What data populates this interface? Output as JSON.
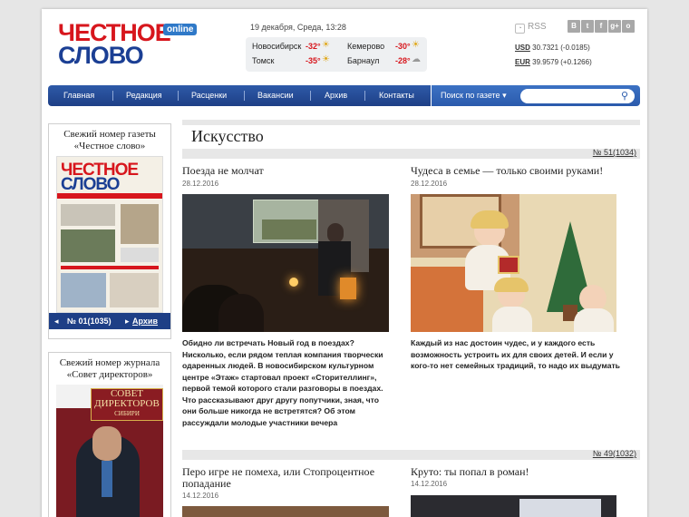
{
  "logo": {
    "line1": "ЧЕСТНОЕ",
    "line2": "СЛОВО",
    "badge": "online"
  },
  "header": {
    "date": "19 декабря, Среда,  13:28"
  },
  "weather": [
    {
      "city": "Новосибирск",
      "temp": "-32°"
    },
    {
      "city": "Кемерово",
      "temp": "-30°"
    },
    {
      "city": "Томск",
      "temp": "-35°"
    },
    {
      "city": "Барнаул",
      "temp": "-28°"
    }
  ],
  "rss": "RSS",
  "socials": [
    "В",
    "t",
    "f",
    "g+",
    "о"
  ],
  "currency": [
    {
      "code": "USD",
      "value": "30.7321 (-0.0185)"
    },
    {
      "code": "EUR",
      "value": "39.9579 (+0.1266)"
    }
  ],
  "nav": [
    "Главная",
    "Редакция",
    "Расценки",
    "Вакансии",
    "Архив",
    "Контакты"
  ],
  "search": {
    "label": "Поиск по газете",
    "placeholder": ""
  },
  "sidebar": {
    "paper_title": "Свежий номер газеты «Честное слово»",
    "paper_cover_line1": "ЧЕСТНОЕ",
    "paper_cover_line2": "СЛОВО",
    "issue_number": "№ 01(1035)",
    "archive": "Архив",
    "mag_title": "Свежий номер журнала «Совет директоров»",
    "mag_cover_line1": "СОВЕТ",
    "mag_cover_line2": "ДИРЕКТОРОВ",
    "mag_cover_line3": "СИБИРИ"
  },
  "section": {
    "title": "Искусство"
  },
  "issues": [
    "№ 51(1034)",
    "№ 49(1032)"
  ],
  "articles": [
    {
      "title": "Поезда не молчат",
      "date": "28.12.2016",
      "text": "Обидно ли встречать Новый год в поездах? Нисколько, если рядом теплая компания творчески одаренных людей. В новосибирском культурном центре «Этаж» стартовал проект «Сторителлинг», первой темой которого стали разговоры в поездах. Что рассказывают друг другу попутчики, зная, что они больше никогда не встретятся? Об этом рассуждали молодые участники вечера"
    },
    {
      "title": "Чудеса в семье — только своими руками!",
      "date": "28.12.2016",
      "text": "Каждый из нас достоин чудес, и у каждого есть возможность устроить их для своих детей. И если у кого-то нет семейных традиций, то надо их выдумать"
    },
    {
      "title": "Перо игре не помеха, или Стопроцентное попадание",
      "date": "14.12.2016"
    },
    {
      "title": "Круто: ты попал в роман!",
      "date": "14.12.2016"
    }
  ]
}
